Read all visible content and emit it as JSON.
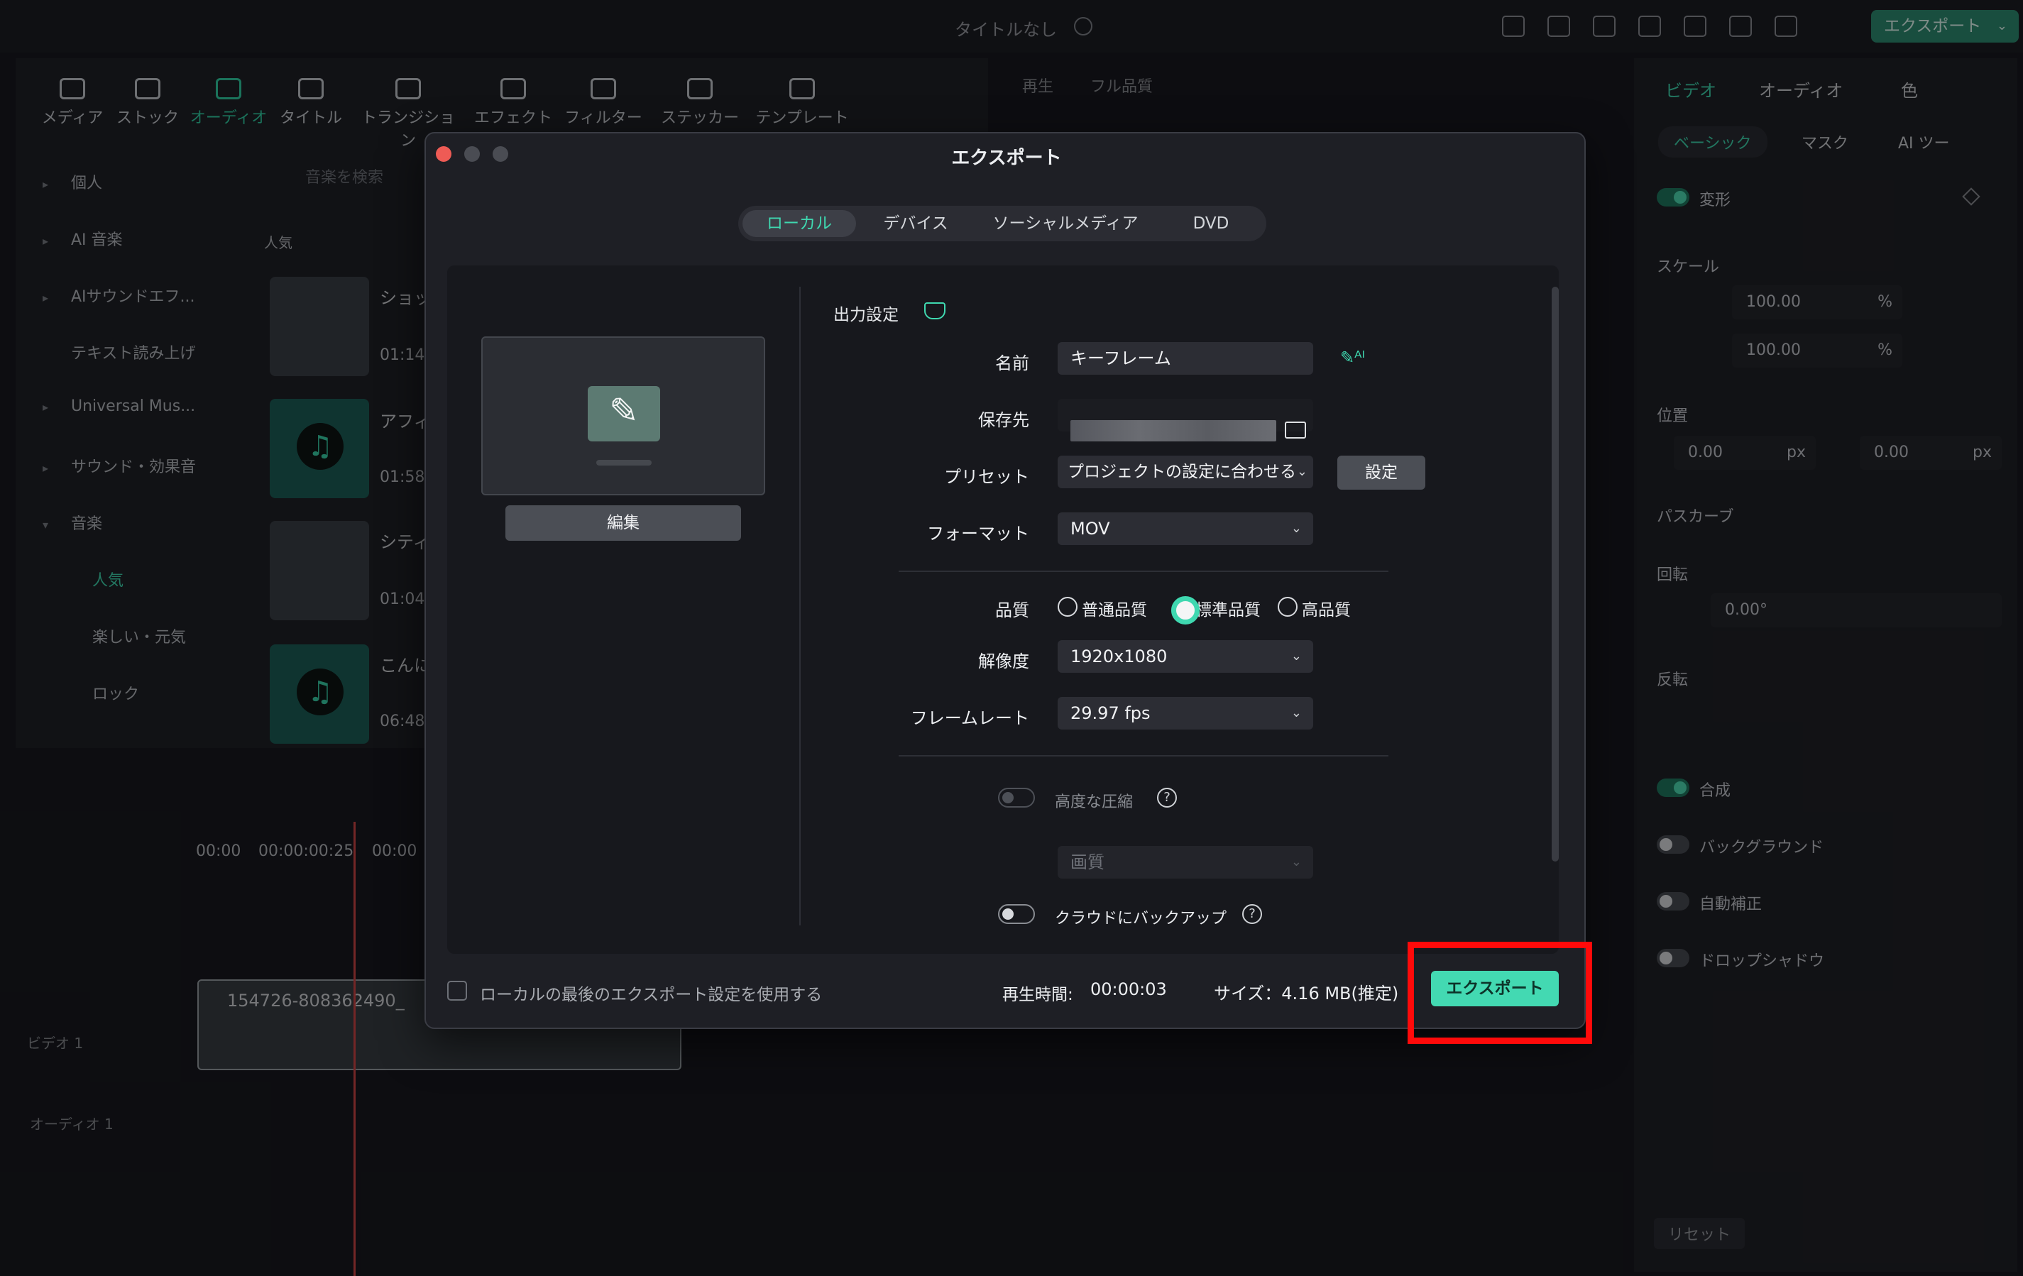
{
  "app": {
    "window_title": "タイトルなし",
    "top_export_label": "エクスポート"
  },
  "toolbar": {
    "tabs": [
      {
        "label": "メディア"
      },
      {
        "label": "ストック"
      },
      {
        "label": "オーディオ"
      },
      {
        "label": "タイトル"
      },
      {
        "label": "トランジション"
      },
      {
        "label": "エフェクト"
      },
      {
        "label": "フィルター"
      },
      {
        "label": "ステッカー"
      },
      {
        "label": "テンプレート"
      }
    ]
  },
  "sidebar": {
    "items": [
      {
        "label": "個人"
      },
      {
        "label": "AI 音楽"
      },
      {
        "label": "AIサウンドエフ..."
      },
      {
        "label": "テキスト読み上げ"
      },
      {
        "label": "Universal Mus..."
      },
      {
        "label": "サウンド・効果音"
      },
      {
        "label": "音楽"
      },
      {
        "label": "人気"
      },
      {
        "label": "楽しい・元気"
      },
      {
        "label": "ロック"
      }
    ],
    "search_placeholder": "音楽を検索",
    "section_label": "人気"
  },
  "media_list": [
    {
      "title": "ショッ",
      "time": "01:14"
    },
    {
      "title": "アフィ",
      "time": "01:58"
    },
    {
      "title": "シティ",
      "time": "01:04"
    },
    {
      "title": "こんに",
      "time": "06:48"
    }
  ],
  "preview_header": {
    "play_label": "再生",
    "quality": "フル品質"
  },
  "right_panel": {
    "tabs": [
      "ビデオ",
      "オーディオ",
      "色"
    ],
    "subtabs": [
      "ベーシック",
      "マスク",
      "AI ツー"
    ],
    "transform": "変形",
    "scale": "スケール",
    "scale_x": "100.00",
    "scale_y": "100.00",
    "position": "位置",
    "pos_x": "0.00",
    "pos_y": "0.00",
    "path_curve": "パスカーブ",
    "rotation": "回転",
    "rotation_val": "0.00°",
    "flip": "反転",
    "composite": "合成",
    "background": "バックグラウンド",
    "auto_correct": "自動補正",
    "drop_shadow": "ドロップシャドウ",
    "reset": "リセット",
    "unit_percent": "%",
    "unit_px": "px"
  },
  "timeline": {
    "times": [
      "00:00",
      "00:00:00:25",
      "00:00"
    ],
    "track_video": "ビデオ 1",
    "track_audio": "オーディオ 1",
    "clip_name": "154726-808362490_"
  },
  "dialog": {
    "title": "エクスポート",
    "tabs": [
      "ローカル",
      "デバイス",
      "ソーシャルメディア",
      "DVD"
    ],
    "edit_button": "編集",
    "section_title": "出力設定",
    "name_label": "名前",
    "name_value": "キーフレーム",
    "save_label": "保存先",
    "preset_label": "プリセット",
    "preset_value": "プロジェクトの設定に合わせる",
    "preset_button": "設定",
    "format_label": "フォーマット",
    "format_value": "MOV",
    "quality_label": "品質",
    "quality_options": [
      "普通品質",
      "標準品質",
      "高品質"
    ],
    "quality_selected": "標準品質",
    "resolution_label": "解像度",
    "resolution_value": "1920x1080",
    "framerate_label": "フレームレート",
    "framerate_value": "29.97 fps",
    "advanced_compression": "高度な圧縮",
    "image_quality": "画質",
    "cloud_backup": "クラウドにバックアップ",
    "use_last_settings": "ローカルの最後のエクスポート設定を使用する",
    "duration_label": "再生時間:",
    "duration_value": "00:00:03",
    "size_text": "サイズ：4.16 MB(推定)",
    "export_button": "エクスポート",
    "help_glyph": "?"
  },
  "colors": {
    "accent": "#3fd8b0",
    "highlight": "#ff0a0a",
    "dialog_bg": "#1e1f25"
  }
}
